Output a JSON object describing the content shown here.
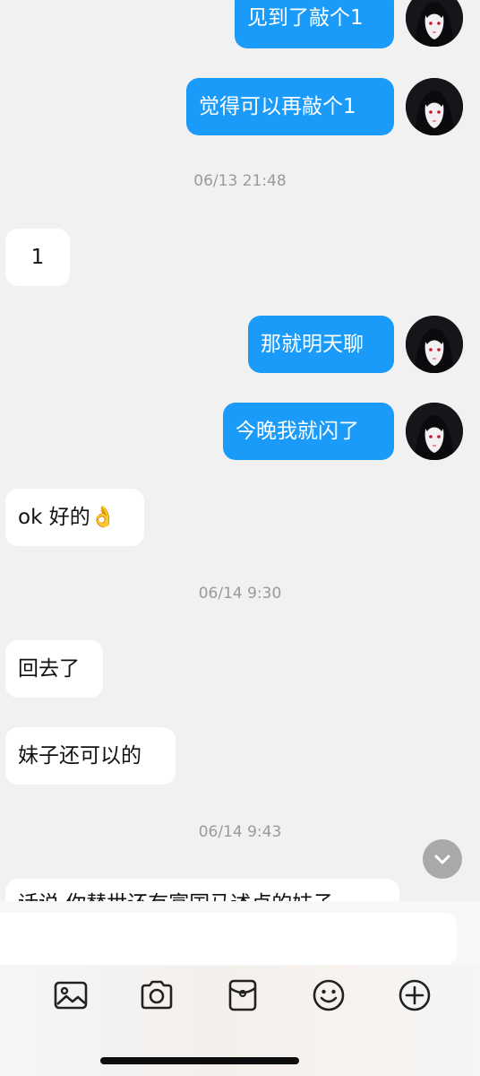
{
  "messages": {
    "m1": "见到了敲个1",
    "m2": "觉得可以再敲个1",
    "m3": "1",
    "m4": "那就明天聊",
    "m5": "今晚我就闪了",
    "m6": "ok 好的👌",
    "m7": "回去了",
    "m8": "妹子还可以的",
    "m9": "话说 你替世还有富国马述卢的妹子"
  },
  "timestamps": {
    "t1": "06/13 21:48",
    "t2": "06/14 9:30",
    "t3": "06/14 9:43"
  },
  "input": {
    "placeholder": ""
  },
  "toolbar": {
    "icons": [
      "image-icon",
      "camera-icon",
      "red-packet-icon",
      "emoji-icon",
      "plus-icon"
    ]
  },
  "colors": {
    "sent_bubble": "#1a9bf9",
    "received_bubble": "#ffffff",
    "background": "#f1f1f1"
  }
}
